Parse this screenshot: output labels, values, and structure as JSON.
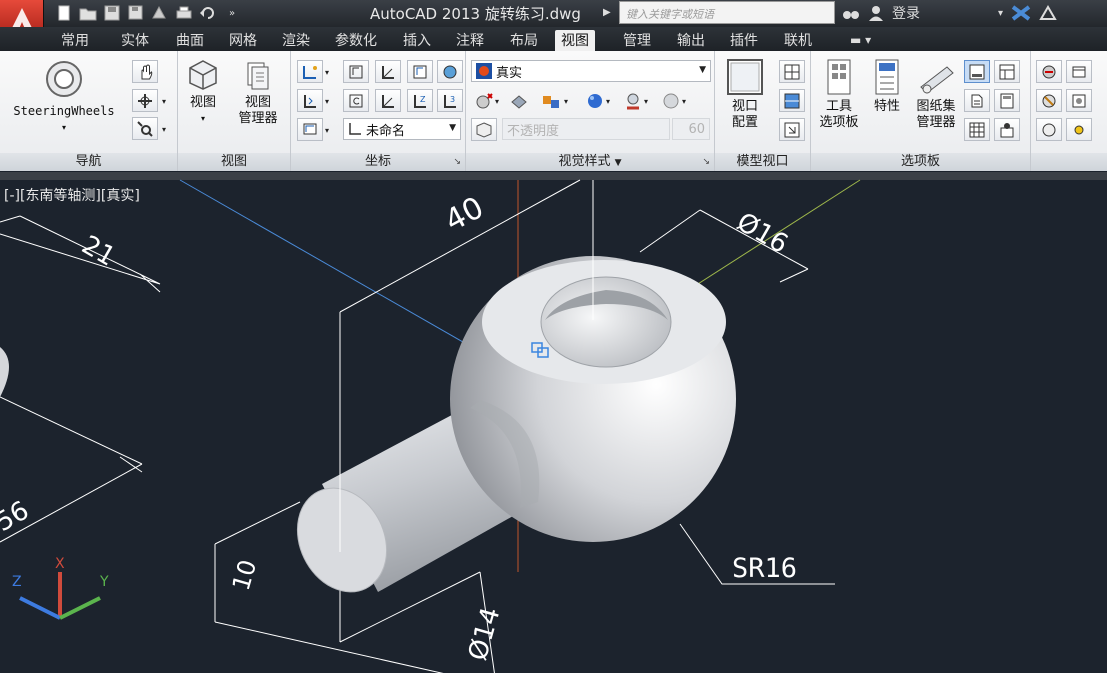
{
  "window": {
    "title": "AutoCAD 2013    旋转练习.dwg",
    "search_placeholder": "键入关键字或短语",
    "login_label": "登录"
  },
  "tabs": [
    "常用",
    "实体",
    "曲面",
    "网格",
    "渲染",
    "参数化",
    "插入",
    "注释",
    "布局",
    "视图",
    "管理",
    "输出",
    "插件",
    "联机"
  ],
  "active_tab": "视图",
  "ribbon": {
    "navigation": {
      "label": "导航",
      "steering_label": "SteeringWheels"
    },
    "views": {
      "label": "视图",
      "view_label": "视图",
      "view_manager_label_1": "视图",
      "view_manager_label_2": "管理器"
    },
    "ucs": {
      "label": "坐标",
      "ucs_combo": "未命名"
    },
    "visual_styles": {
      "label": "视觉样式",
      "style_combo": "真实",
      "opacity_placeholder": "不透明度",
      "opacity_value": "60"
    },
    "model_viewports": {
      "label": "模型视口",
      "viewport_config_1": "视口",
      "viewport_config_2": "配置"
    },
    "palettes": {
      "label": "选项板",
      "tool_palettes_1": "工具",
      "tool_palettes_2": "选项板",
      "properties": "特性",
      "sheet_set_1": "图纸集",
      "sheet_set_2": "管理器"
    }
  },
  "viewport": {
    "view_label": "[-][东南等轴测][真实]",
    "dimensions": [
      "40",
      "21",
      "Ø16",
      "SR16",
      "10",
      "Ø14",
      "56"
    ],
    "ucs_axes": [
      "X",
      "Y",
      "Z"
    ]
  },
  "colors": {
    "accent": "#c0392b",
    "active_tab_bg": "#f0f0f0",
    "viewport_bg": "#1c232d",
    "dimension_color": "#ffffff"
  }
}
